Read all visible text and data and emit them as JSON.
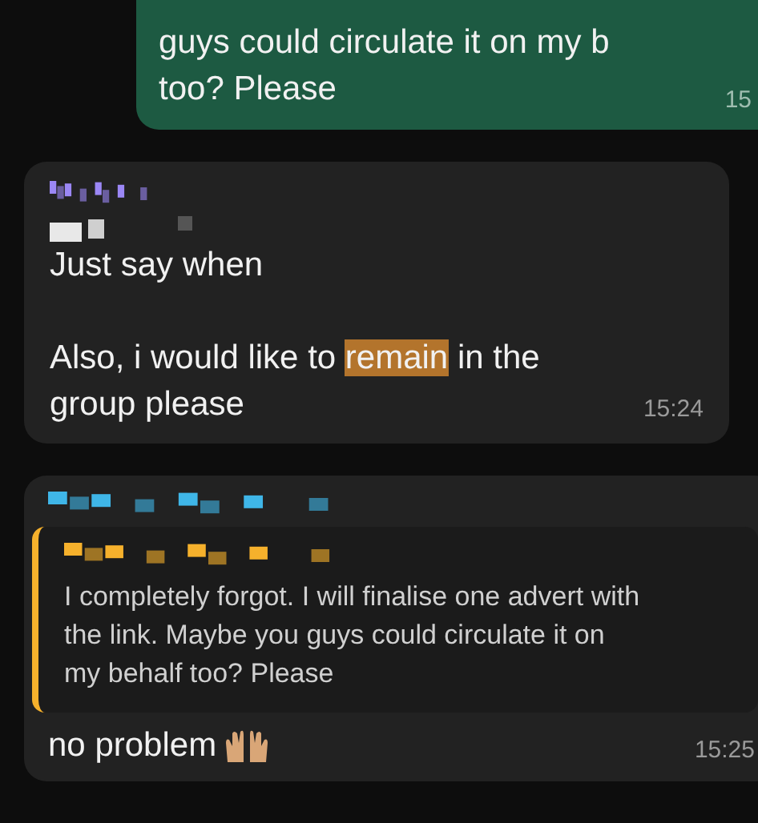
{
  "messages": [
    {
      "kind": "outgoing",
      "paragraphs": [
        [
          "guys could circulate it on my b",
          "too? Please"
        ]
      ],
      "time": "15"
    },
    {
      "kind": "incoming",
      "color": "#9b87f5",
      "paragraphs": [
        [
          "Just say when"
        ],
        [
          "Also, i would like to **remain** in the",
          "group please"
        ]
      ],
      "time": "15:24"
    },
    {
      "kind": "reply",
      "color": "#3fb6e8",
      "quote": {
        "color": "#f6b12c",
        "text": "I completely forgot. I will finalise one advert with the link. Maybe you guys could circulate it on my behalf too? Please"
      },
      "paragraphs": [
        [
          "no problem"
        ]
      ],
      "time": "15:25"
    }
  ]
}
